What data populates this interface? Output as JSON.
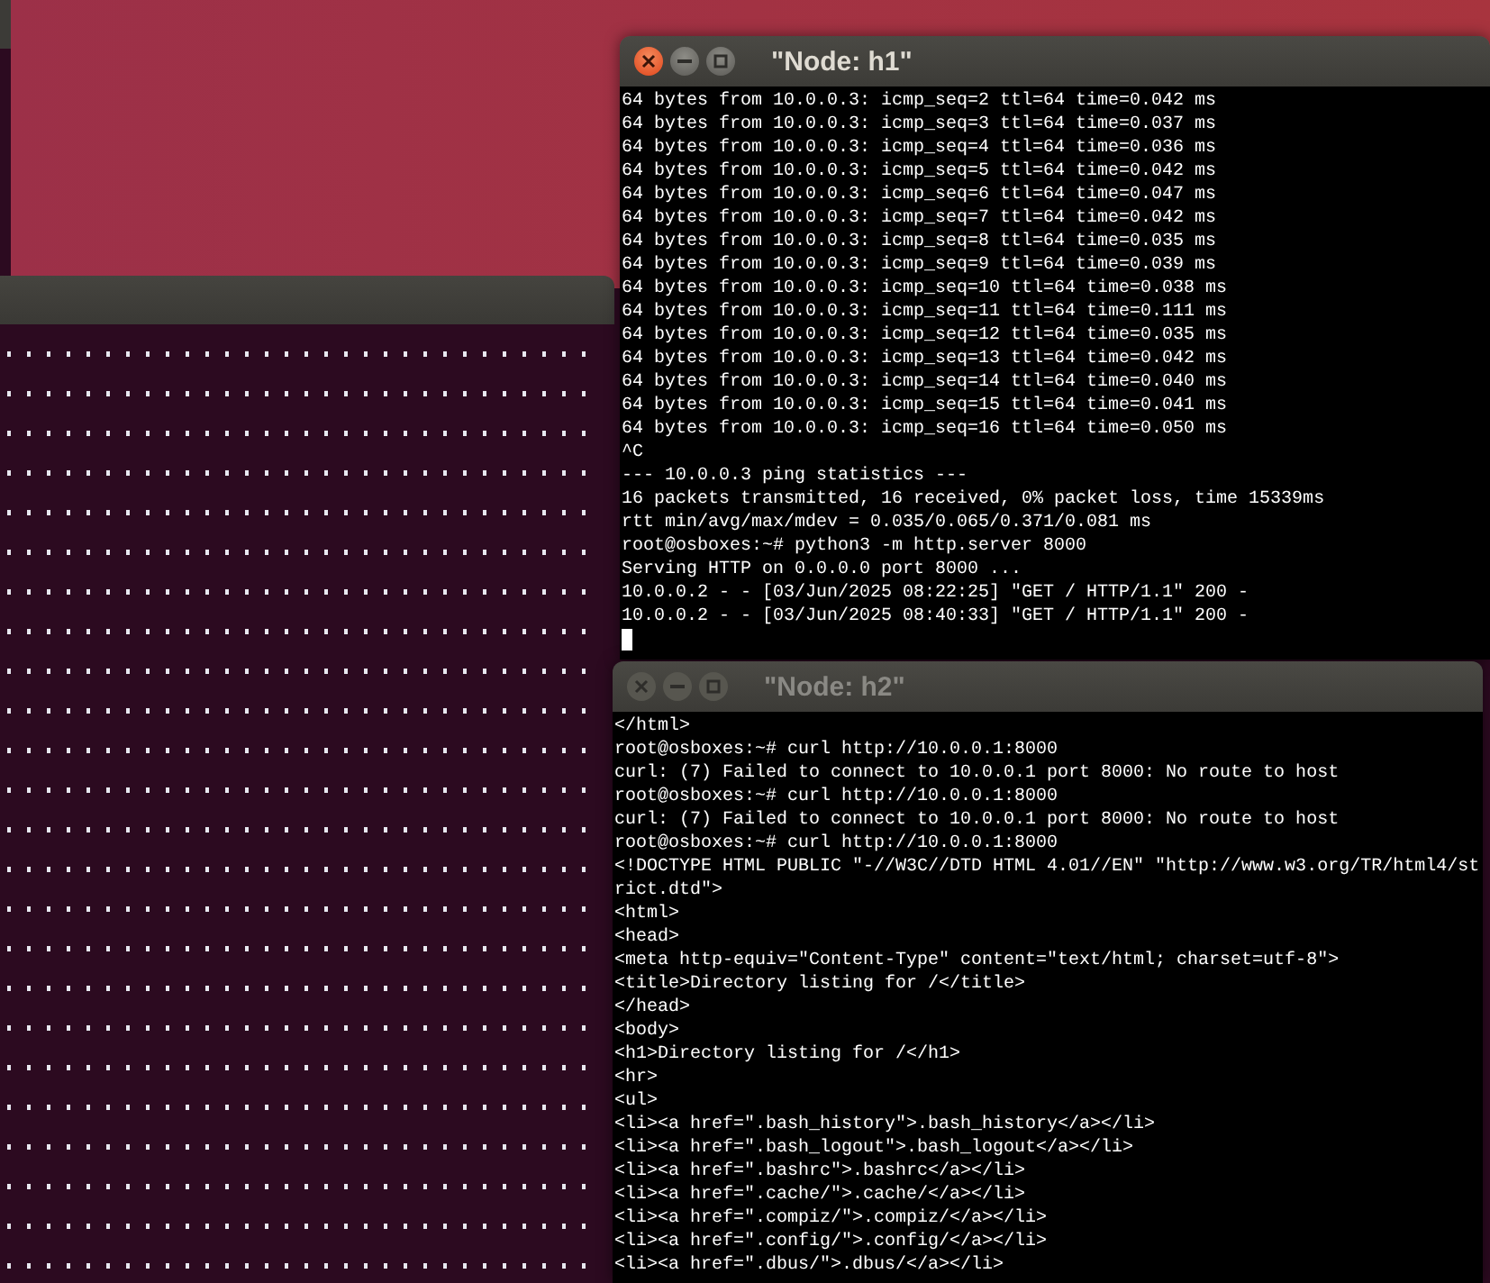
{
  "windows": [
    {
      "title": "\"Node: h1\"",
      "active": true,
      "cursor": true,
      "lines": [
        "64 bytes from 10.0.0.3: icmp_seq=2 ttl=64 time=0.042 ms",
        "64 bytes from 10.0.0.3: icmp_seq=3 ttl=64 time=0.037 ms",
        "64 bytes from 10.0.0.3: icmp_seq=4 ttl=64 time=0.036 ms",
        "64 bytes from 10.0.0.3: icmp_seq=5 ttl=64 time=0.042 ms",
        "64 bytes from 10.0.0.3: icmp_seq=6 ttl=64 time=0.047 ms",
        "64 bytes from 10.0.0.3: icmp_seq=7 ttl=64 time=0.042 ms",
        "64 bytes from 10.0.0.3: icmp_seq=8 ttl=64 time=0.035 ms",
        "64 bytes from 10.0.0.3: icmp_seq=9 ttl=64 time=0.039 ms",
        "64 bytes from 10.0.0.3: icmp_seq=10 ttl=64 time=0.038 ms",
        "64 bytes from 10.0.0.3: icmp_seq=11 ttl=64 time=0.111 ms",
        "64 bytes from 10.0.0.3: icmp_seq=12 ttl=64 time=0.035 ms",
        "64 bytes from 10.0.0.3: icmp_seq=13 ttl=64 time=0.042 ms",
        "64 bytes from 10.0.0.3: icmp_seq=14 ttl=64 time=0.040 ms",
        "64 bytes from 10.0.0.3: icmp_seq=15 ttl=64 time=0.041 ms",
        "64 bytes from 10.0.0.3: icmp_seq=16 ttl=64 time=0.050 ms",
        "^C",
        "--- 10.0.0.3 ping statistics ---",
        "16 packets transmitted, 16 received, 0% packet loss, time 15339ms",
        "rtt min/avg/max/mdev = 0.035/0.065/0.371/0.081 ms",
        "root@osboxes:~# python3 -m http.server 8000",
        "Serving HTTP on 0.0.0.0 port 8000 ...",
        "10.0.0.2 - - [03/Jun/2025 08:22:25] \"GET / HTTP/1.1\" 200 -",
        "10.0.0.2 - - [03/Jun/2025 08:40:33] \"GET / HTTP/1.1\" 200 -"
      ]
    },
    {
      "title": "\"Node: h2\"",
      "active": false,
      "cursor": false,
      "lines": [
        "</html>",
        "root@osboxes:~# curl http://10.0.0.1:8000",
        "curl: (7) Failed to connect to 10.0.0.1 port 8000: No route to host",
        "root@osboxes:~# curl http://10.0.0.1:8000",
        "curl: (7) Failed to connect to 10.0.0.1 port 8000: No route to host",
        "root@osboxes:~# curl http://10.0.0.1:8000",
        "<!DOCTYPE HTML PUBLIC \"-//W3C//DTD HTML 4.01//EN\" \"http://www.w3.org/TR/html4/st",
        "rict.dtd\">",
        "<html>",
        "<head>",
        "<meta http-equiv=\"Content-Type\" content=\"text/html; charset=utf-8\">",
        "<title>Directory listing for /</title>",
        "</head>",
        "<body>",
        "<h1>Directory listing for /</h1>",
        "<hr>",
        "<ul>",
        "<li><a href=\".bash_history\">.bash_history</a></li>",
        "<li><a href=\".bash_logout\">.bash_logout</a></li>",
        "<li><a href=\".bashrc\">.bashrc</a></li>",
        "<li><a href=\".cache/\">.cache/</a></li>",
        "<li><a href=\".compiz/\">.compiz/</a></li>",
        "<li><a href=\".config/\">.config/</a></li>",
        "<li><a href=\".dbus/\">.dbus/</a></li>"
      ]
    }
  ]
}
